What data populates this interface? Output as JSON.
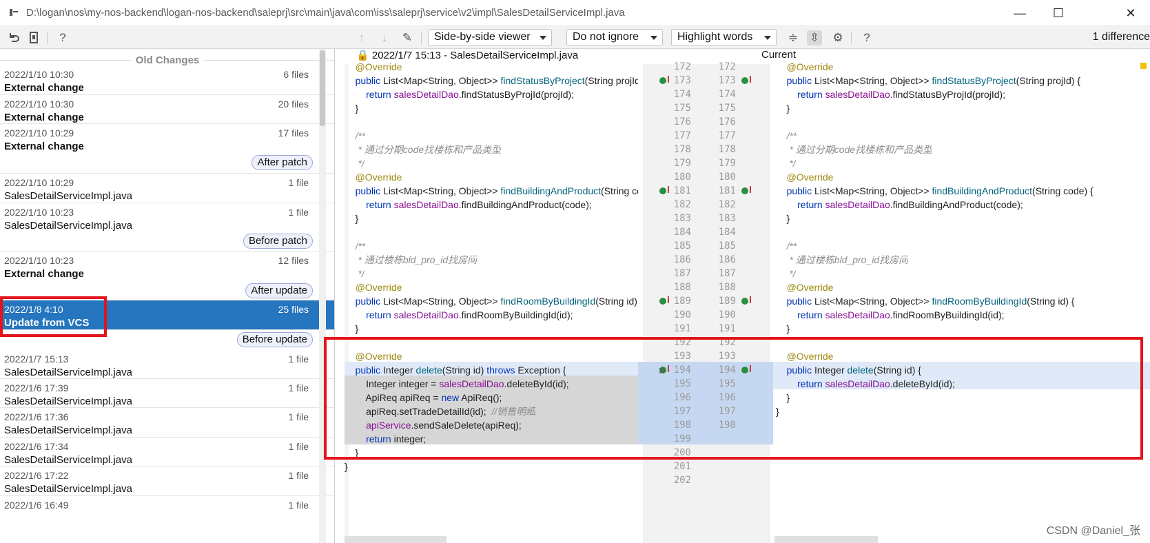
{
  "window": {
    "path": "D:\\logan\\nos\\my-nos-backend\\logan-nos-backend\\saleprj\\src\\main\\java\\com\\iss\\saleprj\\service\\v2\\impl\\SalesDetailServiceImpl.java",
    "minimize": "—",
    "maximize": "☐",
    "close": "✕"
  },
  "toolbar": {
    "viewer": "Side-by-side viewer",
    "ignore": "Do not ignore",
    "highlight": "Highlight words",
    "difference_count": "1 difference",
    "icons": [
      "revert-icon",
      "file-icon",
      "help-icon",
      "up-arrow-icon",
      "down-arrow-icon",
      "edit-icon",
      "collapse-icon",
      "sync-scroll-icon",
      "settings-icon",
      "help-icon"
    ]
  },
  "history": {
    "section_title": "Old Changes",
    "items": [
      {
        "time": "2022/1/10 10:30",
        "count": "6 files",
        "name": "External change",
        "bold": true
      },
      {
        "time": "2022/1/10 10:30",
        "count": "20 files",
        "name": "External change",
        "bold": true
      },
      {
        "time": "2022/1/10 10:29",
        "count": "17 files",
        "name": "External change",
        "bold": true
      },
      {
        "time": "2022/1/10 10:29",
        "count": "1 file",
        "name": "SalesDetailServiceImpl.java",
        "bold": false
      },
      {
        "time": "2022/1/10 10:23",
        "count": "1 file",
        "name": "SalesDetailServiceImpl.java",
        "bold": false
      },
      {
        "time": "2022/1/10 10:23",
        "count": "12 files",
        "name": "External change",
        "bold": true
      },
      {
        "time": "2022/1/8 4:10",
        "count": "25 files",
        "name": "Update from VCS",
        "bold": true,
        "selected": true
      },
      {
        "time": "2022/1/7 15:13",
        "count": "1 file",
        "name": "SalesDetailServiceImpl.java",
        "bold": false
      },
      {
        "time": "2022/1/6 17:39",
        "count": "1 file",
        "name": "SalesDetailServiceImpl.java",
        "bold": false
      },
      {
        "time": "2022/1/6 17:36",
        "count": "1 file",
        "name": "SalesDetailServiceImpl.java",
        "bold": false
      },
      {
        "time": "2022/1/6 17:34",
        "count": "1 file",
        "name": "SalesDetailServiceImpl.java",
        "bold": false
      },
      {
        "time": "2022/1/6 17:22",
        "count": "1 file",
        "name": "SalesDetailServiceImpl.java",
        "bold": false
      },
      {
        "time": "2022/1/6 16:49",
        "count": "1 file",
        "name": "",
        "bold": false
      }
    ],
    "labels": [
      "After patch",
      "Before patch",
      "After update",
      "Before update"
    ]
  },
  "diff": {
    "left_title": "2022/1/7 15:13 - SalesDetailServiceImpl.java",
    "right_title": "Current",
    "left_lines": [
      "172",
      "173",
      "174",
      "175",
      "176",
      "177",
      "178",
      "179",
      "180",
      "181",
      "182",
      "183",
      "184",
      "185",
      "186",
      "187",
      "188",
      "189",
      "190",
      "191",
      "192",
      "193",
      "194",
      "195",
      "196",
      "197",
      "198",
      "199",
      "200",
      "201",
      "202"
    ],
    "right_lines": [
      "172",
      "173",
      "174",
      "175",
      "176",
      "177",
      "178",
      "179",
      "180",
      "181",
      "182",
      "183",
      "184",
      "185",
      "186",
      "187",
      "188",
      "189",
      "190",
      "191",
      "192",
      "193",
      "194",
      "195",
      "196",
      "197",
      "198"
    ],
    "comment1": " * 通过分期code找楼栋和产品类型",
    "comment2": " * 通过楼栋bld_pro_id找房间",
    "comment3": "//销售明细"
  },
  "watermark": "CSDN @Daniel_张"
}
